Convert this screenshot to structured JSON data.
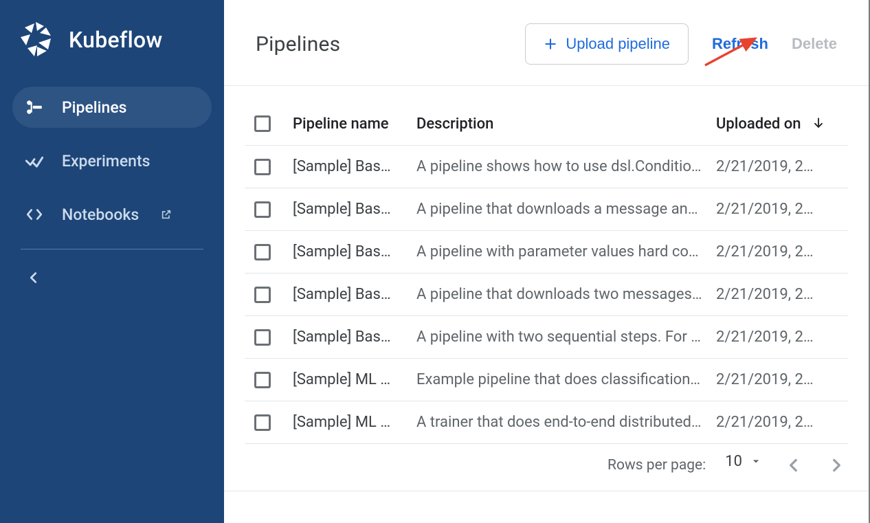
{
  "brand": {
    "name": "Kubeflow"
  },
  "sidebar": {
    "items": [
      {
        "label": "Pipelines"
      },
      {
        "label": "Experiments"
      },
      {
        "label": "Notebooks"
      }
    ]
  },
  "header": {
    "title": "Pipelines",
    "upload_label": "Upload pipeline",
    "refresh_label": "Refresh",
    "delete_label": "Delete"
  },
  "table": {
    "columns": {
      "name": "Pipeline name",
      "description": "Description",
      "uploaded": "Uploaded on"
    },
    "rows": [
      {
        "name": "[Sample] Bas…",
        "description": "A pipeline shows how to use dsl.Condition. …",
        "uploaded": "2/21/2019, 2…"
      },
      {
        "name": "[Sample] Bas…",
        "description": "A pipeline that downloads a message and p…",
        "uploaded": "2/21/2019, 2…"
      },
      {
        "name": "[Sample] Bas…",
        "description": "A pipeline with parameter values hard code…",
        "uploaded": "2/21/2019, 2…"
      },
      {
        "name": "[Sample] Bas…",
        "description": "A pipeline that downloads two messages in…",
        "uploaded": "2/21/2019, 2…"
      },
      {
        "name": "[Sample] Bas…",
        "description": "A pipeline with two sequential steps. For so…",
        "uploaded": "2/21/2019, 2…"
      },
      {
        "name": "[Sample] ML …",
        "description": "Example pipeline that does classification w…",
        "uploaded": "2/21/2019, 2…"
      },
      {
        "name": "[Sample] ML …",
        "description": "A trainer that does end-to-end distributed tr…",
        "uploaded": "2/21/2019, 2…"
      }
    ]
  },
  "pager": {
    "rows_label": "Rows per page:",
    "rows_value": "10"
  }
}
